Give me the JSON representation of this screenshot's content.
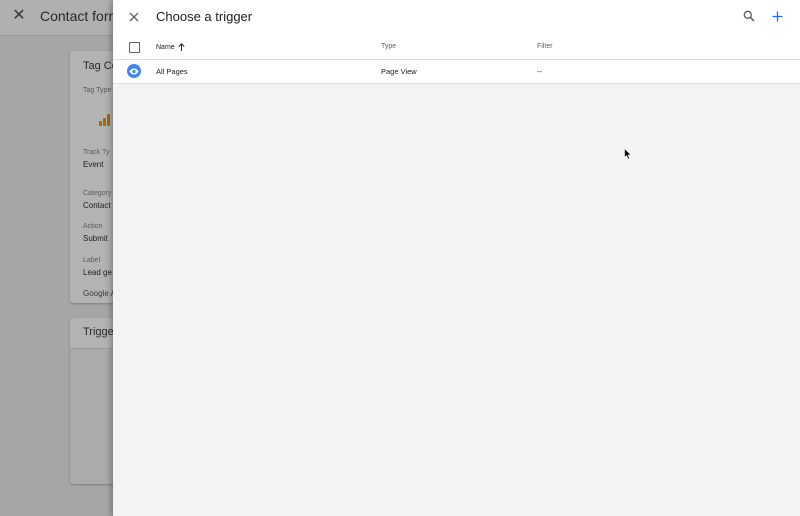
{
  "background": {
    "title": "Contact form",
    "config_card": {
      "title": "Tag Co",
      "tag_type_label": "Tag Type",
      "track_type_label": "Track Ty",
      "track_type_value": "Event",
      "category_label": "Category",
      "category_value": "Contact",
      "action_label": "Action",
      "action_value": "Submit",
      "label_label": "Label",
      "label_value": "Lead ge",
      "google_label": "Google A"
    },
    "triggering_card": {
      "title": "Trigger"
    }
  },
  "panel": {
    "title": "Choose a trigger",
    "icons": {
      "close": "close-icon",
      "search": "search-icon",
      "add": "add-icon"
    },
    "columns": {
      "name": "Name",
      "type": "Type",
      "filter": "Filter"
    },
    "rows": [
      {
        "name": "All Pages",
        "type": "Page View",
        "filter": "--",
        "icon": "eye-icon"
      }
    ]
  },
  "colors": {
    "accent": "#4285f4",
    "analytics": "#f9ab00"
  }
}
